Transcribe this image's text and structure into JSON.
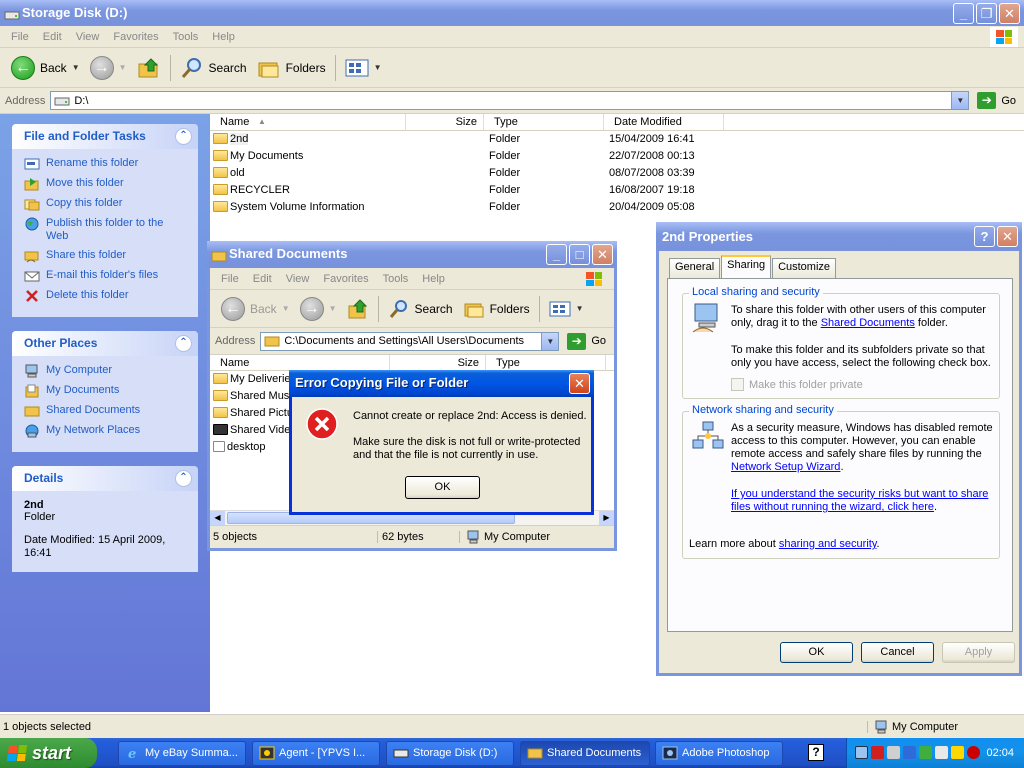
{
  "main": {
    "title": "Storage Disk (D:)",
    "menu": [
      "File",
      "Edit",
      "View",
      "Favorites",
      "Tools",
      "Help"
    ],
    "toolbar": {
      "back": "Back",
      "search": "Search",
      "folders": "Folders"
    },
    "address_label": "Address",
    "address": "D:\\",
    "go": "Go",
    "columns": {
      "name": "Name",
      "size": "Size",
      "type": "Type",
      "date": "Date Modified"
    },
    "files": [
      {
        "name": "2nd",
        "type": "Folder",
        "date": "15/04/2009 16:41"
      },
      {
        "name": "My Documents",
        "type": "Folder",
        "date": "22/07/2008 00:13"
      },
      {
        "name": "old",
        "type": "Folder",
        "date": "08/07/2008 03:39"
      },
      {
        "name": "RECYCLER",
        "type": "Folder",
        "date": "16/08/2007 19:18"
      },
      {
        "name": "System Volume Information",
        "type": "Folder",
        "date": "20/04/2009 05:08"
      }
    ],
    "status_left": "1 objects selected",
    "status_right": "My Computer"
  },
  "taskpane": {
    "file_tasks": {
      "title": "File and Folder Tasks",
      "items": [
        "Rename this folder",
        "Move this folder",
        "Copy this folder",
        "Publish this folder to the Web",
        "Share this folder",
        "E-mail this folder's files",
        "Delete this folder"
      ]
    },
    "other_places": {
      "title": "Other Places",
      "items": [
        "My Computer",
        "My Documents",
        "Shared Documents",
        "My Network Places"
      ]
    },
    "details": {
      "title": "Details",
      "name": "2nd",
      "kind": "Folder",
      "modified": "Date Modified: 15 April 2009, 16:41"
    }
  },
  "shared": {
    "title": "Shared Documents",
    "menu": [
      "File",
      "Edit",
      "View",
      "Favorites",
      "Tools",
      "Help"
    ],
    "toolbar": {
      "back": "Back",
      "search": "Search",
      "folders": "Folders"
    },
    "address_label": "Address",
    "address": "C:\\Documents and Settings\\All Users\\Documents",
    "go": "Go",
    "columns": {
      "name": "Name",
      "size": "Size",
      "type": "Type"
    },
    "files": [
      "My Deliveries",
      "Shared Music",
      "Shared Pictures",
      "Shared Video",
      "desktop"
    ],
    "status": {
      "objects": "5 objects",
      "size": "62 bytes",
      "location": "My Computer"
    }
  },
  "error": {
    "title": "Error Copying File or Folder",
    "line1": "Cannot create or replace 2nd: Access is denied.",
    "line2": "Make sure the disk is not full or write-protected and that the file is not currently in use.",
    "ok": "OK"
  },
  "props": {
    "title": "2nd Properties",
    "tabs": [
      "General",
      "Sharing",
      "Customize"
    ],
    "local_group": "Local sharing and security",
    "local_p1_pre": "To share this folder with other users of this computer only, drag it to the ",
    "local_p1_link": "Shared Documents",
    "local_p1_post": " folder.",
    "local_p2": "To make this folder and its subfolders private so that only you have access, select the following check box.",
    "private_label": "Make this folder private",
    "network_group": "Network sharing and security",
    "network_p1": "As a security measure, Windows has disabled remote access to this computer. However, you can enable remote access and safely share files by running the",
    "network_wizard_link": "Network Setup Wizard",
    "network_risk_link": "If you understand the security risks but want to share files without running the wizard, click here",
    "learn_pre": "Learn more about ",
    "learn_link": "sharing and security",
    "ok": "OK",
    "cancel": "Cancel",
    "apply": "Apply"
  },
  "taskbar": {
    "start": "start",
    "tasks": [
      "My eBay Summa...",
      "Agent - [YPVS I...",
      "Storage Disk (D:)",
      "Shared Documents",
      "Adobe Photoshop"
    ],
    "clock": "02:04"
  }
}
